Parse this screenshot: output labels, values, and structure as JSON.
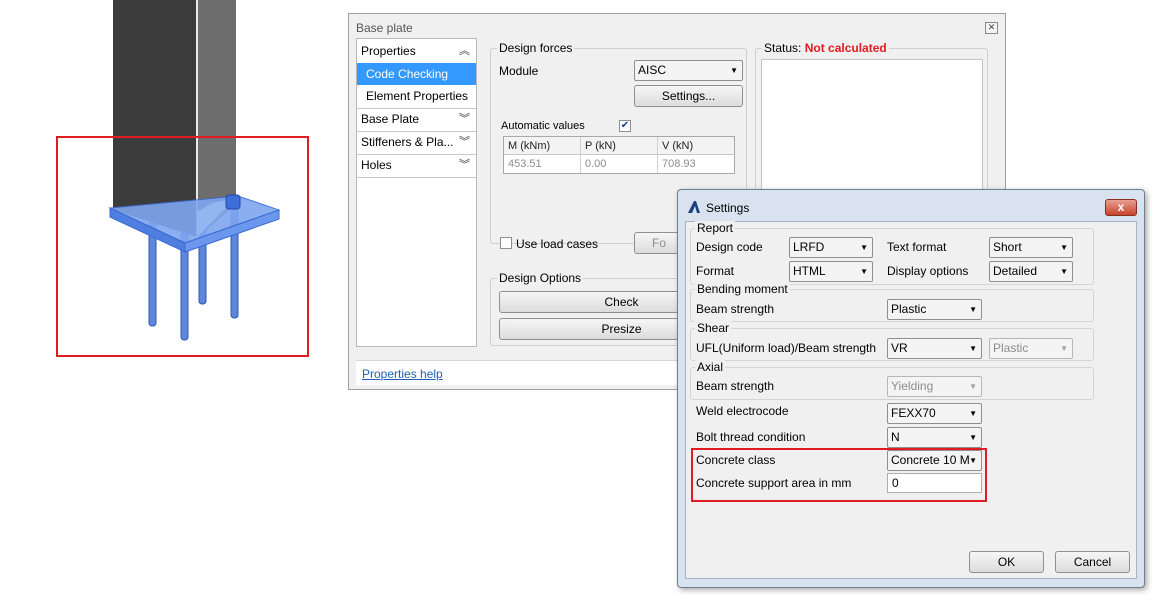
{
  "colors": {
    "highlight": "#e11b22",
    "selection": "#3399ff",
    "status_red": "#e11b22",
    "link": "#1f5fb5"
  },
  "base_plate_dialog": {
    "title": "Base plate",
    "close_icon": "close-icon",
    "nav": {
      "properties": "Properties",
      "code_checking": "Code Checking",
      "element_properties": "Element Properties",
      "base_plate": "Base Plate",
      "stiffeners": "Stiffeners & Pla...",
      "holes": "Holes"
    },
    "design_forces": {
      "group_label": "Design forces",
      "module_label": "Module",
      "module_value": "AISC",
      "settings_button": "Settings...",
      "automatic_values_label": "Automatic values",
      "automatic_values_checked": true,
      "table": {
        "headers": [
          "M (kNm)",
          "P (kN)",
          "V (kN)"
        ],
        "values": [
          "453.51",
          "0.00",
          "708.93"
        ]
      },
      "use_load_cases_label": "Use load cases",
      "for_button": "Fo"
    },
    "design_options": {
      "group_label": "Design Options",
      "check_button": "Check",
      "presize_button": "Presize"
    },
    "status": {
      "label": "Status:",
      "value": "Not calculated"
    },
    "help_link": "Properties help"
  },
  "settings_dialog": {
    "title": "Settings",
    "close_label": "x",
    "report": {
      "group_label": "Report",
      "design_code_label": "Design code",
      "design_code_value": "LRFD",
      "text_format_label": "Text format",
      "text_format_value": "Short",
      "format_label": "Format",
      "format_value": "HTML",
      "display_options_label": "Display options",
      "display_options_value": "Detailed"
    },
    "bending": {
      "group_label": "Bending moment",
      "beam_strength_label": "Beam strength",
      "beam_strength_value": "Plastic"
    },
    "shear": {
      "group_label": "Shear",
      "ufl_label": "UFL(Uniform load)/Beam strength",
      "ufl_value": "VR",
      "second_value": "Plastic"
    },
    "axial": {
      "group_label": "Axial",
      "beam_strength_label": "Beam strength",
      "beam_strength_value": "Yielding"
    },
    "weld_label": "Weld electrocode",
    "weld_value": "FEXX70",
    "bolt_label": "Bolt thread condition",
    "bolt_value": "N",
    "concrete_class_label": "Concrete class",
    "concrete_class_value": "Concrete 10 M",
    "concrete_area_label": "Concrete support area in mm",
    "concrete_area_value": "0",
    "ok_button": "OK",
    "cancel_button": "Cancel"
  }
}
